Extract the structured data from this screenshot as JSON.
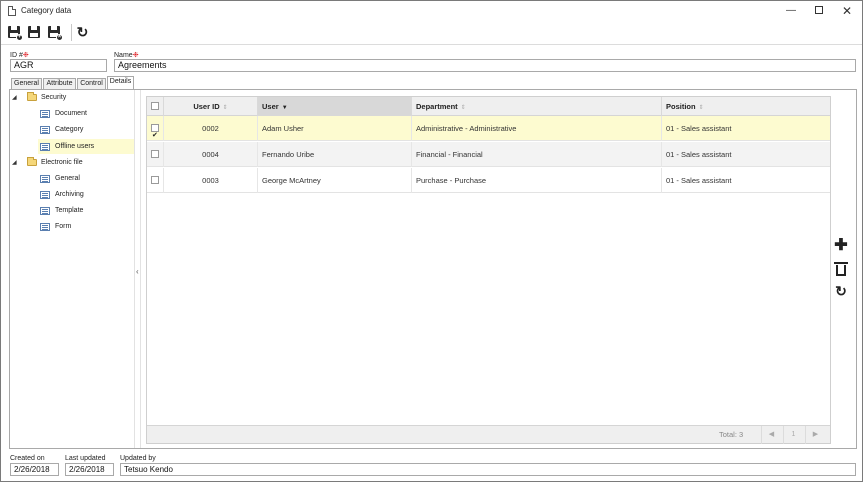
{
  "window": {
    "title": "Category data"
  },
  "toolbar": {
    "buttons": [
      "save-and-new-icon",
      "save-icon",
      "save-and-close-icon",
      "refresh-icon"
    ]
  },
  "fields": {
    "id_label": "ID #",
    "id_value": "AGR",
    "name_label": "Name",
    "name_value": "Agreements"
  },
  "tabs": [
    {
      "label": "General"
    },
    {
      "label": "Attribute"
    },
    {
      "label": "Control"
    },
    {
      "label": "Details",
      "active": true
    }
  ],
  "tree": {
    "groups": [
      {
        "label": "Security",
        "items": [
          "Document",
          "Category",
          "Offline users"
        ]
      },
      {
        "label": "Electronic file",
        "items": [
          "General",
          "Archiving",
          "Template",
          "Form"
        ]
      }
    ],
    "selected": "Offline users"
  },
  "grid": {
    "columns": [
      "User ID",
      "User",
      "Department",
      "Position"
    ],
    "sorted_column": "User",
    "rows": [
      {
        "checked": true,
        "user_id": "0002",
        "user": "Adam Usher",
        "department": "Administrative - Administrative",
        "position": "01 - Sales assistant"
      },
      {
        "checked": false,
        "user_id": "0004",
        "user": "Fernando Uribe",
        "department": "Financial - Financial",
        "position": "01 - Sales assistant"
      },
      {
        "checked": false,
        "user_id": "0003",
        "user": "George McArtney",
        "department": "Purchase - Purchase",
        "position": "01 - Sales assistant"
      }
    ],
    "footer": {
      "total": "Total: 3",
      "page": "1",
      "prev": "◀",
      "next": "▶"
    }
  },
  "actions": [
    "add-icon",
    "delete-icon",
    "refresh-icon"
  ],
  "footer": {
    "created_label": "Created on",
    "created_value": "2/26/2018",
    "updated_label": "Last updated",
    "updated_value": "2/26/2018",
    "updated_by_label": "Updated by",
    "updated_by_value": "Tetsuo Kendo"
  },
  "colors": {
    "selected_row": "#fdfbd0",
    "required_mark": "#e0262c",
    "folder": "#f5d77a"
  }
}
